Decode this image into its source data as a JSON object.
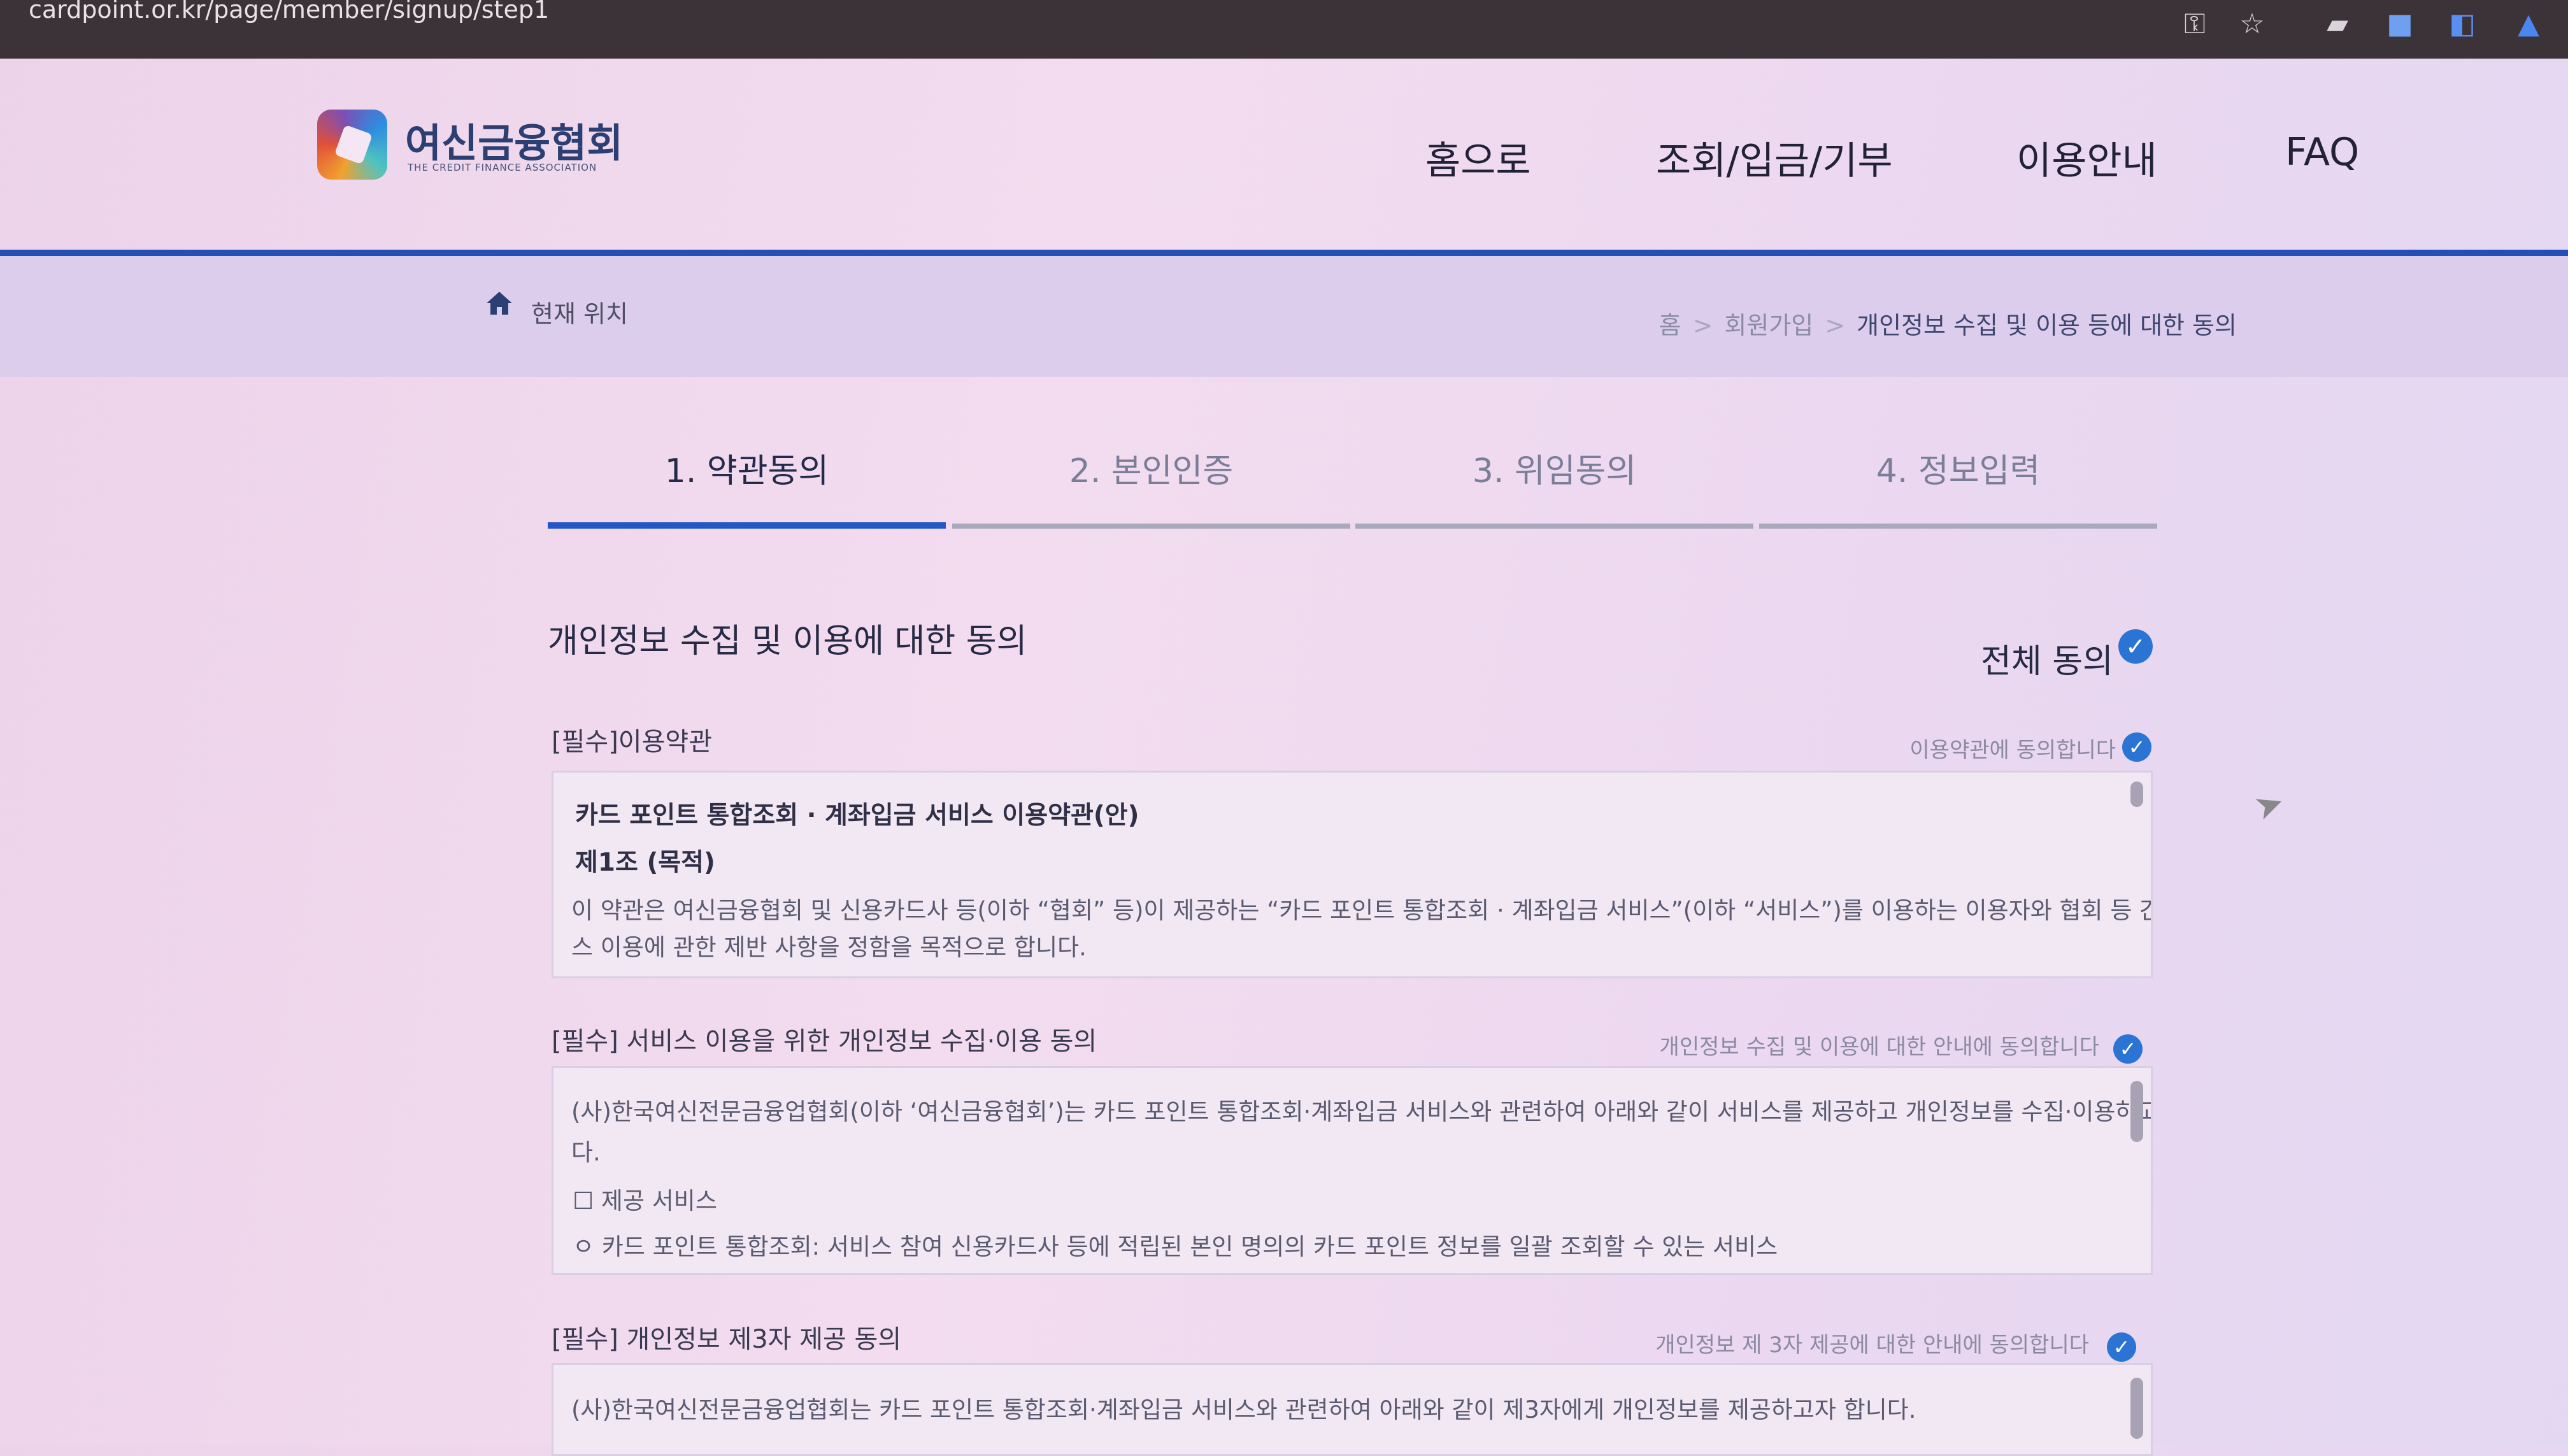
{
  "browser": {
    "url": "cardpoint.or.kr/page/member/signup/step1",
    "icons": [
      "key-icon",
      "star-icon",
      "extension-icon",
      "extension-icon",
      "translate-icon",
      "profile-icon"
    ]
  },
  "header": {
    "logo_text": "여신금융협회",
    "logo_sub": "THE CREDIT FINANCE ASSOCIATION",
    "nav": [
      "홈으로",
      "조회/입금/기부",
      "이용안내",
      "FAQ"
    ]
  },
  "breadcrumb": {
    "label": "현재 위치",
    "items": [
      "홈",
      "회원가입",
      "개인정보 수집 및 이용 등에 대한 동의"
    ]
  },
  "steps": [
    {
      "label": "1. 약관동의",
      "active": true
    },
    {
      "label": "2. 본인인증",
      "active": false
    },
    {
      "label": "3. 위임동의",
      "active": false
    },
    {
      "label": "4. 정보입력",
      "active": false
    }
  ],
  "section": {
    "title": "개인정보 수집 및 이용에 대한 동의",
    "all_agree": "전체 동의"
  },
  "terms": [
    {
      "title": "[필수]이용약관",
      "hint": "이용약관에 동의합니다",
      "lines": [
        "카드 포인트 통합조회 · 계좌입금 서비스 이용약관(안)",
        "제1조 (목적)",
        "이 약관은 여신금융협회 및 신용카드사 등(이하 “협회” 등)이 제공하는 “카드 포인트 통합조회 · 계좌입금 서비스”(이하 “서비스”)를 이용하는 이용자와 협회 등 간의 서비",
        "스 이용에 관한 제반 사항을 정함을 목적으로 합니다."
      ]
    },
    {
      "title": "[필수] 서비스 이용을 위한 개인정보 수집·이용 동의",
      "hint": "개인정보 수집 및 이용에 대한 안내에 동의합니다",
      "lines": [
        "(사)한국여신전문금융업협회(이하 ‘여신금융협회’)는 카드 포인트 통합조회·계좌입금 서비스와 관련하여 아래와 같이 서비스를 제공하고 개인정보를 수집·이용하고자 합니",
        "다.",
        "☐ 제공 서비스",
        "ㅇ 카드 포인트 통합조회: 서비스 참여 신용카드사 등에 적립된 본인 명의의 카드 포인트 정보를 일괄 조회할 수 있는 서비스"
      ]
    },
    {
      "title": "[필수] 개인정보 제3자 제공 동의",
      "hint": "개인정보 제 3자 제공에 대한 안내에 동의합니다",
      "lines": [
        "(사)한국여신전문금융업협회는 카드 포인트 통합조회·계좌입금 서비스와 관련하여 아래와 같이 제3자에게 개인정보를 제공하고자 합니다."
      ]
    }
  ]
}
